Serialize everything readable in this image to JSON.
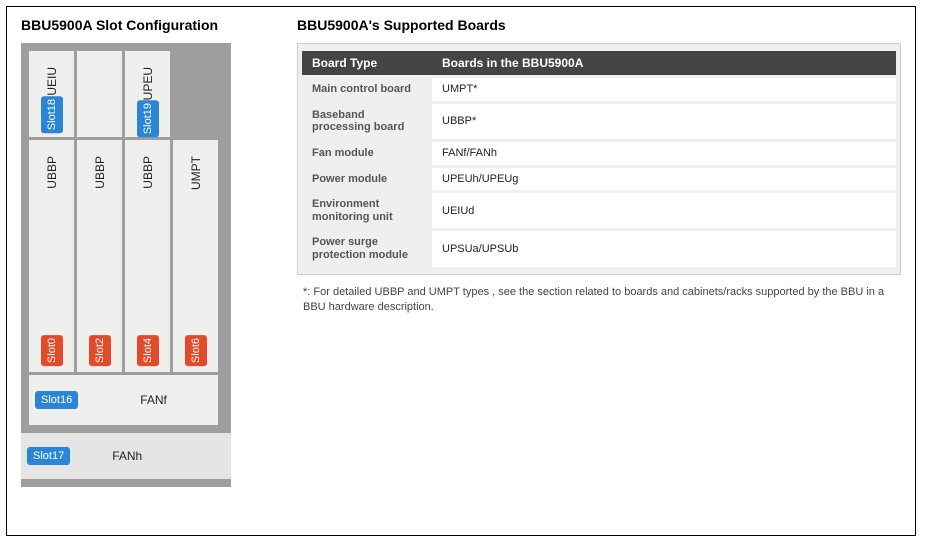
{
  "left": {
    "heading": "BBU5900A Slot Configuration",
    "top_slots": [
      {
        "slot_badge": "Slot18",
        "badge_color": "blue",
        "label": "UEIU"
      },
      {
        "slot_badge": "",
        "badge_color": "",
        "label": ""
      },
      {
        "slot_badge": "Slot19",
        "badge_color": "blue",
        "label": "UPEU"
      }
    ],
    "mid_slots": [
      {
        "slot_badge": "Slot0",
        "badge_color": "orange",
        "label": "UBBP"
      },
      {
        "slot_badge": "Slot2",
        "badge_color": "orange",
        "label": "UBBP"
      },
      {
        "slot_badge": "Slot4",
        "badge_color": "orange",
        "label": "UBBP"
      },
      {
        "slot_badge": "Slot6",
        "badge_color": "orange",
        "label": "UMPT"
      }
    ],
    "fanf": {
      "slot_badge": "Slot16",
      "label": "FANf"
    },
    "fanh": {
      "slot_badge": "Slot17",
      "label": "FANh"
    }
  },
  "right": {
    "heading": "BBU5900A's Supported Boards",
    "table": {
      "header": {
        "col1": "Board Type",
        "col2": "Boards in the BBU5900A"
      },
      "rows": [
        {
          "type": "Main control board",
          "boards": "UMPT*"
        },
        {
          "type": "Baseband processing board",
          "boards": "UBBP*"
        },
        {
          "type": "Fan module",
          "boards": "FANf/FANh"
        },
        {
          "type": "Power module",
          "boards": "UPEUh/UPEUg"
        },
        {
          "type": "Environment monitoring unit",
          "boards": "UEIUd"
        },
        {
          "type": "Power surge protection module",
          "boards": "UPSUa/UPSUb"
        }
      ]
    },
    "footnote": "*: For detailed UBBP and UMPT types , see the section related to boards and cabinets/racks supported by the BBU in a BBU hardware description."
  }
}
